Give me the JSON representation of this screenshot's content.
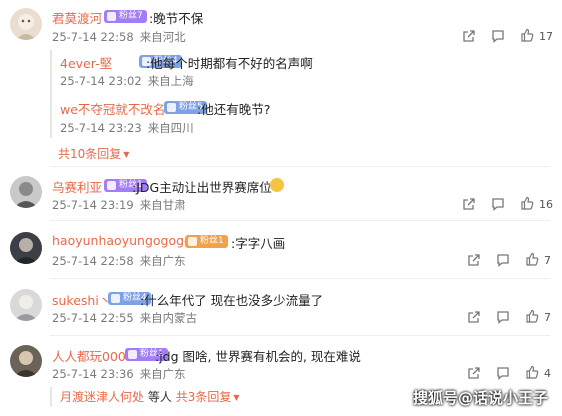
{
  "colors": {
    "username": "#e8694a",
    "badge_purple": "#a27df5",
    "badge_blue": "#7fa2e6",
    "badge_orange": "#f0a14a",
    "text": "#222222",
    "meta": "#7a7a7a"
  },
  "comments": [
    {
      "username": "君莫渡河",
      "badge": "粉丝7",
      "text": ":晚节不保",
      "date": "25-7-14 22:58",
      "location": "来自河北",
      "likes": "17",
      "replies": [
        {
          "username": "4ever-堅",
          "badge": "粉丝4",
          "text": ":他每个时期都有不好的名声啊",
          "date": "25-7-14 23:02",
          "location": "来自上海"
        },
        {
          "username": "we不夺冠就不改名",
          "badge": "粉丝5",
          "text": ":他还有晚节?",
          "date": "25-7-14 23:23",
          "location": "来自四川"
        }
      ],
      "more_replies": "共10条回复"
    },
    {
      "username": "乌赛利亚",
      "badge": "粉丝1",
      "text": ":JDG主动让出世界赛席位",
      "date": "25-7-14 23:19",
      "location": "来自甘肃",
      "likes": "16"
    },
    {
      "username": "haoyunhaoyungogogo",
      "badge": "粉丝1",
      "text": ":字字八画",
      "date": "25-7-14 22:58",
      "location": "来自广东",
      "likes": "7"
    },
    {
      "username": "sukeshi丶",
      "badge": "粉丝4",
      "text": ":什么年代了 现在也没多少流量了",
      "date": "25-7-14 22:55",
      "location": "来自内蒙古",
      "likes": "7"
    },
    {
      "username": "人人都玩000",
      "badge": "粉丝1",
      "text": ":jdg 图啥, 世界赛有机会的, 现在难说",
      "date": "25-7-14 23:36",
      "location": "来自广东",
      "likes": "4",
      "reply_preview_user": "月渡迷津人何处",
      "reply_preview_suffix": "等人",
      "more_replies": "共3条回复"
    }
  ],
  "watermark": "搜狐号@话说小王子",
  "icons": {
    "share": "share-icon",
    "comment": "comment-icon",
    "like": "thumbs-up-icon",
    "expand": "chevron-down-icon"
  }
}
